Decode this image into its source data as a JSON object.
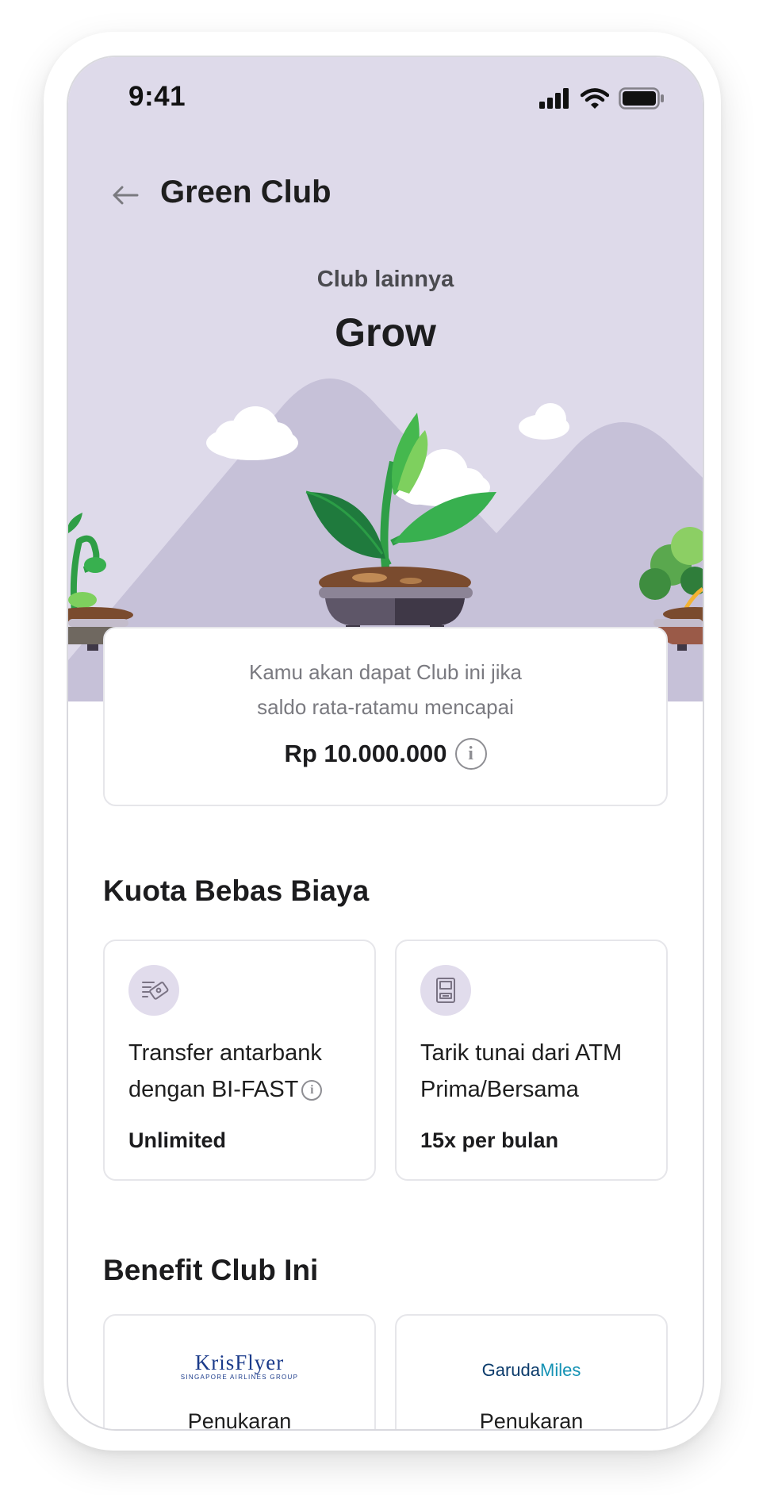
{
  "status_bar": {
    "time": "9:41"
  },
  "header": {
    "title": "Green Club"
  },
  "hero": {
    "subtitle": "Club lainnya",
    "club_name": "Grow"
  },
  "requirement": {
    "line1": "Kamu akan dapat Club ini jika",
    "line2": "saldo rata-ratamu mencapai",
    "amount": "Rp 10.000.000",
    "info_glyph": "i"
  },
  "quota": {
    "title": "Kuota Bebas Biaya",
    "items": [
      {
        "icon": "transfer-icon",
        "label": "Transfer antarbank dengan BI-FAST",
        "value": "Unlimited",
        "has_info": true
      },
      {
        "icon": "atm-icon",
        "label": "Tarik tunai dari ATM Prima/Bersama",
        "value": "15x per bulan",
        "has_info": false
      }
    ]
  },
  "benefits": {
    "title": "Benefit Club Ini",
    "items": [
      {
        "logo_main": "KrisFlyer",
        "logo_sub": "SINGAPORE AIRLINES GROUP",
        "label": "Penukaran"
      },
      {
        "logo_part1": "Garuda",
        "logo_part2": "Miles",
        "label": "Penukaran"
      }
    ]
  },
  "colors": {
    "hero_bg": "#dedaea",
    "mountain": "#c6c1d8",
    "icon_circle": "#e1dcec",
    "leaf_dark": "#1f7a3d",
    "leaf_light": "#38b04f",
    "pot": "#5e5668"
  }
}
